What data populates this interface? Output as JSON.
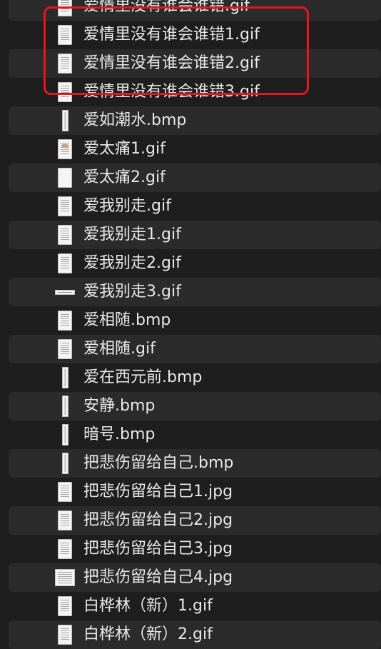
{
  "annotation": {
    "color": "#e8161c"
  },
  "files": [
    {
      "name": "爱情里没有谁会谁错.gif",
      "icon": "sheet-music-icon",
      "partial": true
    },
    {
      "name": "爱情里没有谁会谁错1.gif",
      "icon": "sheet-music-icon"
    },
    {
      "name": "爱情里没有谁会谁错2.gif",
      "icon": "sheet-music-icon"
    },
    {
      "name": "爱情里没有谁会谁错3.gif",
      "icon": "sheet-music-icon"
    },
    {
      "name": "爱如潮水.bmp",
      "icon": "narrow-image-icon"
    },
    {
      "name": "爱太痛1.gif",
      "icon": "sheet-music-color-icon"
    },
    {
      "name": "爱太痛2.gif",
      "icon": "blank-page-icon"
    },
    {
      "name": "爱我别走.gif",
      "icon": "sheet-music-icon"
    },
    {
      "name": "爱我别走1.gif",
      "icon": "sheet-music-icon"
    },
    {
      "name": "爱我别走2.gif",
      "icon": "sheet-music-icon"
    },
    {
      "name": "爱我别走3.gif",
      "icon": "wide-strip-icon"
    },
    {
      "name": "爱相随.bmp",
      "icon": "sheet-music-icon"
    },
    {
      "name": "爱相随.gif",
      "icon": "sheet-music-icon"
    },
    {
      "name": "爱在西元前.bmp",
      "icon": "narrow-image-icon"
    },
    {
      "name": "安静.bmp",
      "icon": "narrow-image-icon"
    },
    {
      "name": "暗号.bmp",
      "icon": "narrow-image-icon"
    },
    {
      "name": "把悲伤留给自己.bmp",
      "icon": "narrow-image-icon"
    },
    {
      "name": "把悲伤留给自己1.jpg",
      "icon": "sheet-music-icon"
    },
    {
      "name": "把悲伤留给自己2.jpg",
      "icon": "sheet-music-icon"
    },
    {
      "name": "把悲伤留给自己3.jpg",
      "icon": "sheet-music-icon"
    },
    {
      "name": "把悲伤留给自己4.jpg",
      "icon": "landscape-sheet-icon"
    },
    {
      "name": "白桦林（新）1.gif",
      "icon": "sheet-music-icon"
    },
    {
      "name": "白桦林（新）2.gif",
      "icon": "sheet-music-icon"
    }
  ]
}
